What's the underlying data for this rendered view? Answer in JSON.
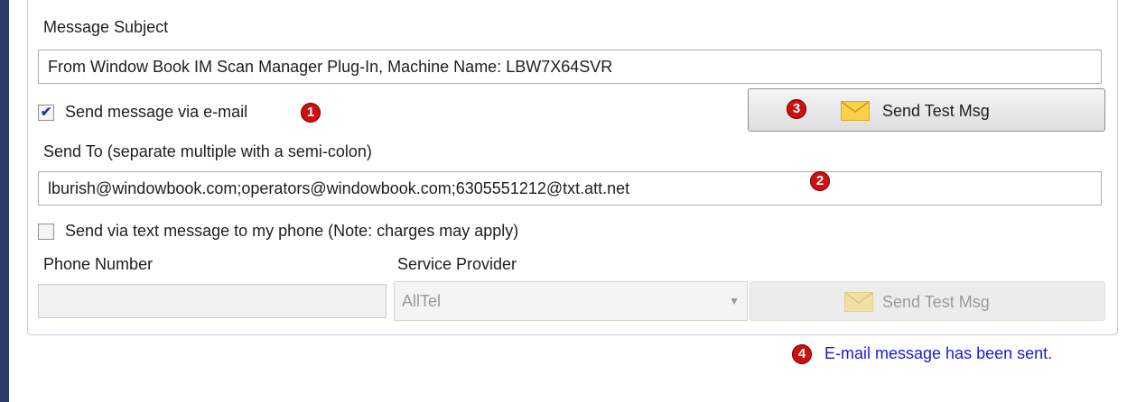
{
  "form": {
    "subject_label": "Message Subject",
    "subject_value": "From Window Book IM Scan Manager Plug-In, Machine Name: LBW7X64SVR",
    "send_email_label": "Send message via e-mail",
    "send_email_checked": true,
    "send_to_label": "Send To (separate multiple with a semi-colon)",
    "send_to_value": "lburish@windowbook.com;operators@windowbook.com;6305551212@txt.att.net",
    "send_text_label": "Send via text message to my phone (Note: charges may apply)",
    "send_text_checked": false,
    "phone_label": "Phone Number",
    "phone_value": "",
    "provider_label": "Service Provider",
    "provider_value": "AllTel",
    "test_email_button": "Send Test Msg",
    "test_text_button": "Send Test Msg"
  },
  "callouts": {
    "one": "1",
    "two": "2",
    "three": "3",
    "four": "4"
  },
  "status": {
    "message": "E-mail message has been sent."
  },
  "colors": {
    "status_text": "#1a1adb",
    "badge": "#cc1111",
    "left_bar": "#2b3d6b"
  },
  "icons": {
    "check": "check-icon",
    "envelope": "envelope-icon",
    "dropdown": "chevron-down-icon"
  }
}
